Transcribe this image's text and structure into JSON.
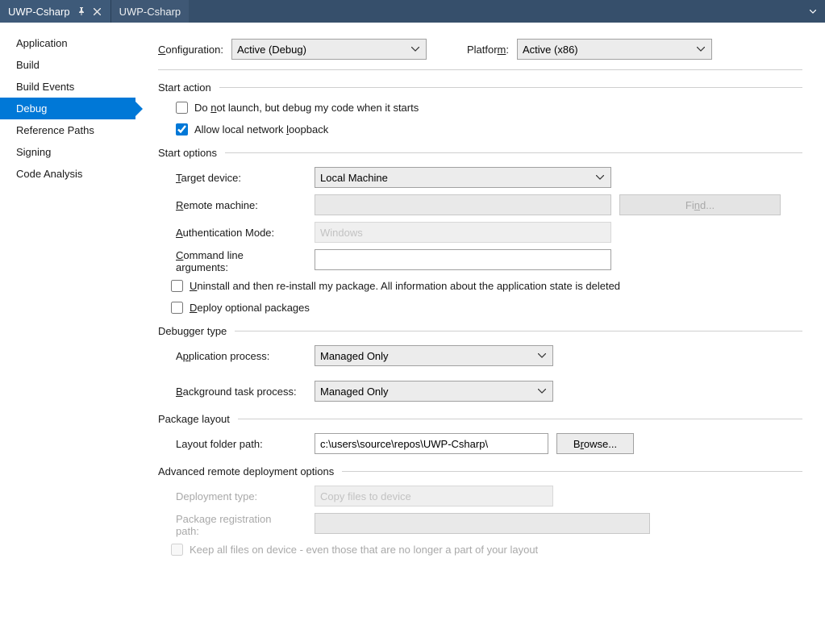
{
  "tabs": {
    "active": "UWP-Csharp",
    "inactive": "UWP-Csharp"
  },
  "sidebar": {
    "items": [
      "Application",
      "Build",
      "Build Events",
      "Debug",
      "Reference Paths",
      "Signing",
      "Code Analysis"
    ],
    "selected_index": 3
  },
  "config_bar": {
    "configuration_label": "Configuration:",
    "configuration_value": "Active (Debug)",
    "platform_label": "Platform:",
    "platform_value": "Active (x86)"
  },
  "sections": {
    "start_action": {
      "title": "Start action",
      "dont_launch_label": "Do not launch, but debug my code when it starts",
      "dont_launch_checked": false,
      "allow_loopback_label": "Allow local network loopback",
      "allow_loopback_checked": true
    },
    "start_options": {
      "title": "Start options",
      "target_device_label": "Target device:",
      "target_device_value": "Local Machine",
      "remote_machine_label": "Remote machine:",
      "remote_machine_value": "",
      "find_button": "Find...",
      "auth_mode_label": "Authentication Mode:",
      "auth_mode_value": "Windows",
      "cmd_args_label_1": "Command line",
      "cmd_args_label_2": "arguments:",
      "cmd_args_value": "",
      "uninstall_label": "Uninstall and then re-install my package. All information about the application state is deleted",
      "uninstall_checked": false,
      "deploy_optional_label": "Deploy optional packages",
      "deploy_optional_checked": false
    },
    "debugger_type": {
      "title": "Debugger type",
      "app_process_label": "Application process:",
      "app_process_value": "Managed Only",
      "bg_process_label": "Background task process:",
      "bg_process_value": "Managed Only"
    },
    "package_layout": {
      "title": "Package layout",
      "layout_folder_label": "Layout folder path:",
      "layout_folder_value": "c:\\users\\source\\repos\\UWP-Csharp\\",
      "browse_button": "Browse..."
    },
    "advanced_remote": {
      "title": "Advanced remote deployment options",
      "deployment_type_label": "Deployment type:",
      "deployment_type_value": "Copy files to device",
      "pkg_reg_label_1": "Package registration",
      "pkg_reg_label_2": "path:",
      "pkg_reg_value": "",
      "keep_files_label": "Keep all files on device - even those that are no longer a part of your layout",
      "keep_files_checked": false
    }
  }
}
